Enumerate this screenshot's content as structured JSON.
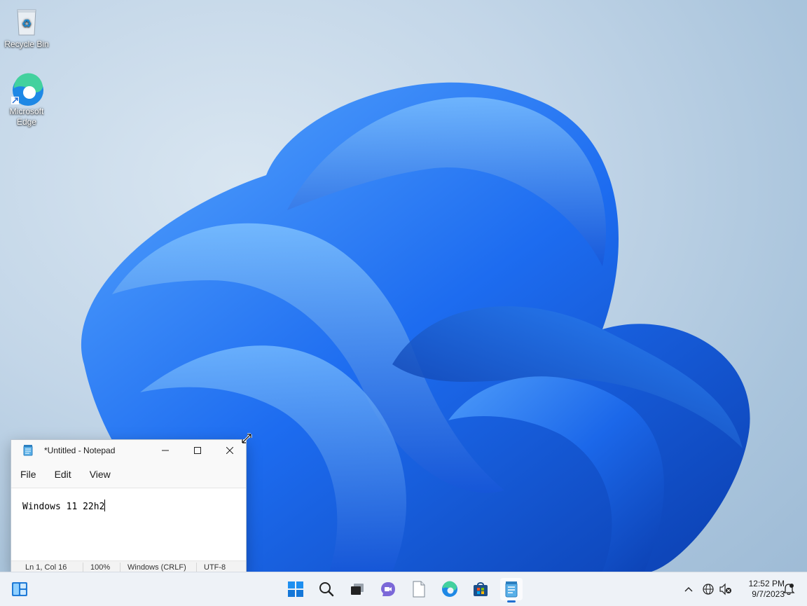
{
  "desktop": {
    "icons": [
      {
        "label": "Recycle Bin",
        "icon": "recycle-bin-icon"
      },
      {
        "label": "Microsoft Edge",
        "label_lines": [
          "Microsoft",
          "Edge"
        ],
        "icon": "edge-icon"
      }
    ]
  },
  "notepad": {
    "title": "*Untitled - Notepad",
    "menu": [
      "File",
      "Edit",
      "View"
    ],
    "content": "Windows 11 22h2",
    "status": {
      "position": "Ln 1, Col 16",
      "zoom": "100%",
      "line_ending": "Windows (CRLF)",
      "encoding": "UTF-8"
    }
  },
  "taskbar": {
    "apps": [
      "widgets-icon",
      "start-icon",
      "search-icon",
      "task-view-icon",
      "chat-icon",
      "file-explorer-icon",
      "edge-icon",
      "store-icon",
      "notepad-icon"
    ],
    "clock": {
      "time": "12:52 PM",
      "date": "9/7/2023"
    }
  },
  "colors": {
    "accent": "#1f6fd1",
    "taskbar": "#eef2f7"
  }
}
